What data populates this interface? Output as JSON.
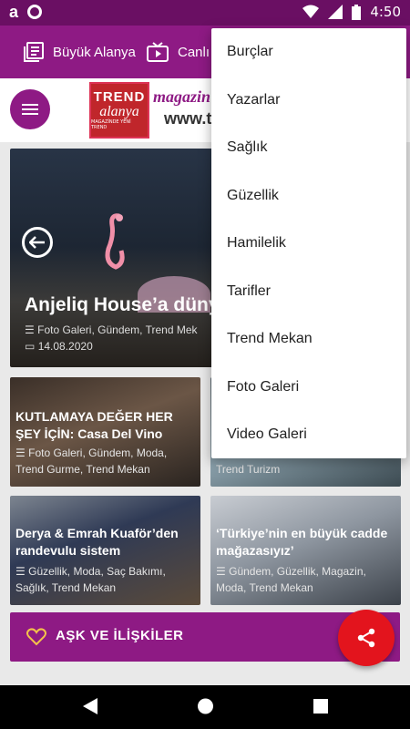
{
  "status_bar": {
    "time": "4:50",
    "app_letter": "a"
  },
  "top_bar": {
    "item1_label": "Büyük Alanya",
    "item2_label": "Canlı"
  },
  "logo": {
    "trend": "TREND",
    "alanya": "alanya",
    "tagline": "MAGAZİNDE YENİ TREND",
    "magazin": "magazin",
    "www": "www.tre"
  },
  "featured": {
    "title": "Anjeliq House’a düny",
    "categories": "Foto Galeri, Gündem, Trend Mek",
    "date": "14.08.2020"
  },
  "cards": [
    {
      "title": "KUTLAMAYA DEĞER HER ŞEY İÇİN: Casa Del Vino",
      "categories": "Foto Galeri, Gündem, Moda, Trend Gurme, Trend Mekan"
    },
    {
      "title": "",
      "categories": "Trend Turizm"
    },
    {
      "title": "Derya & Emrah Kuaför’den randevulu sistem",
      "categories": "Güzellik, Moda, Saç Bakımı, Sağlık, Trend Mekan"
    },
    {
      "title": "‘Türkiye’nin en büyük cadde mağazasıyız’",
      "categories": "Gündem, Güzellik, Magazin, Moda, Trend Mekan"
    }
  ],
  "section": {
    "label": "AŞK VE İLİŞKİLER"
  },
  "menu": {
    "items": [
      "Burçlar",
      "Yazarlar",
      "Sağlık",
      "Güzellik",
      "Hamilelik",
      "Tarifler",
      "Trend Mekan",
      "Foto Galeri",
      "Video Galeri"
    ]
  },
  "colors": {
    "primary": "#8e1a84",
    "status": "#6a0f63",
    "fab": "#e3141d"
  }
}
